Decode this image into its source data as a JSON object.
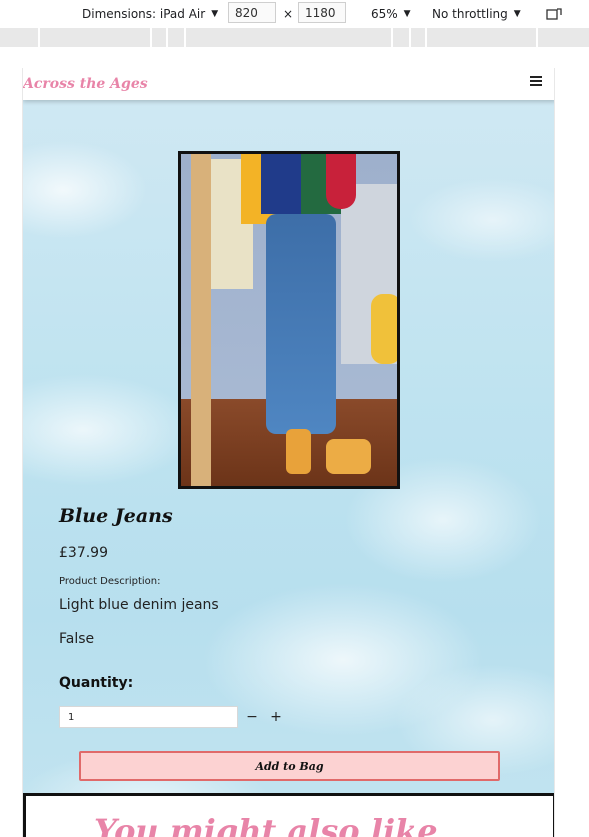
{
  "devtools": {
    "dimensions_label": "Dimensions: iPad Air",
    "width_value": "820",
    "times_sign": "×",
    "height_value": "1180",
    "zoom": "65%",
    "throttling": "No throttling"
  },
  "navbar": {
    "brand": "Across the Ages"
  },
  "product": {
    "title": "Blue Jeans",
    "price": "£37.99",
    "description_label": "Product Description:",
    "description": "Light blue denim jeans",
    "flag_value": "False"
  },
  "quantity": {
    "label": "Quantity:",
    "value": "1",
    "minus_label": "−",
    "plus_label": "+"
  },
  "actions": {
    "add_to_bag": "Add to Bag"
  },
  "suggestions": {
    "heading": "You might also like"
  },
  "colors": {
    "brand_pink": "#e884a8",
    "button_bg": "#fcd2d2",
    "button_border": "#e06a6a"
  }
}
